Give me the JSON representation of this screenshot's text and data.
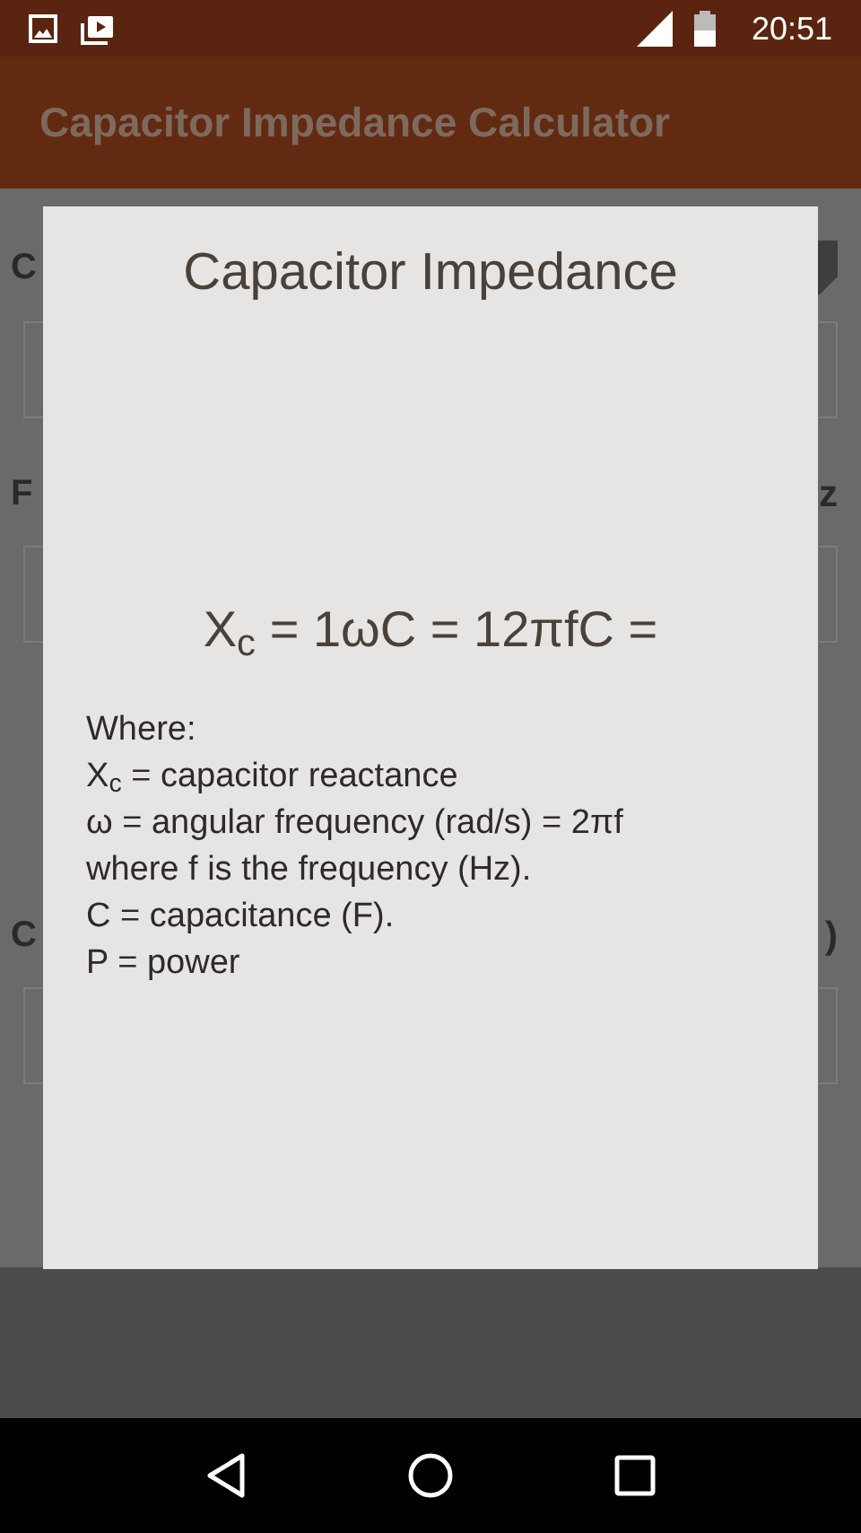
{
  "status_bar": {
    "time": "20:51"
  },
  "app_bar": {
    "title": "Capacitor Impedance Calculator"
  },
  "form_behind": [
    {
      "kind": "label_with_dropdown",
      "left": "C"
    },
    {
      "kind": "field"
    },
    {
      "kind": "label",
      "left": "F",
      "right": "z"
    },
    {
      "kind": "field"
    },
    {
      "kind": "label",
      "left": "C",
      "right": ")"
    },
    {
      "kind": "field"
    }
  ],
  "dialog": {
    "title": "Capacitor Impedance",
    "formula": "X$_{c}$ = 1ωC = 12πfC =",
    "legend": [
      "Where:",
      "X$_{c}$ = capacitor reactance",
      "ω = angular frequency (rad/s) = 2πf",
      "where f is the frequency (Hz).",
      "C = capacitance (F).",
      "P = power"
    ]
  }
}
